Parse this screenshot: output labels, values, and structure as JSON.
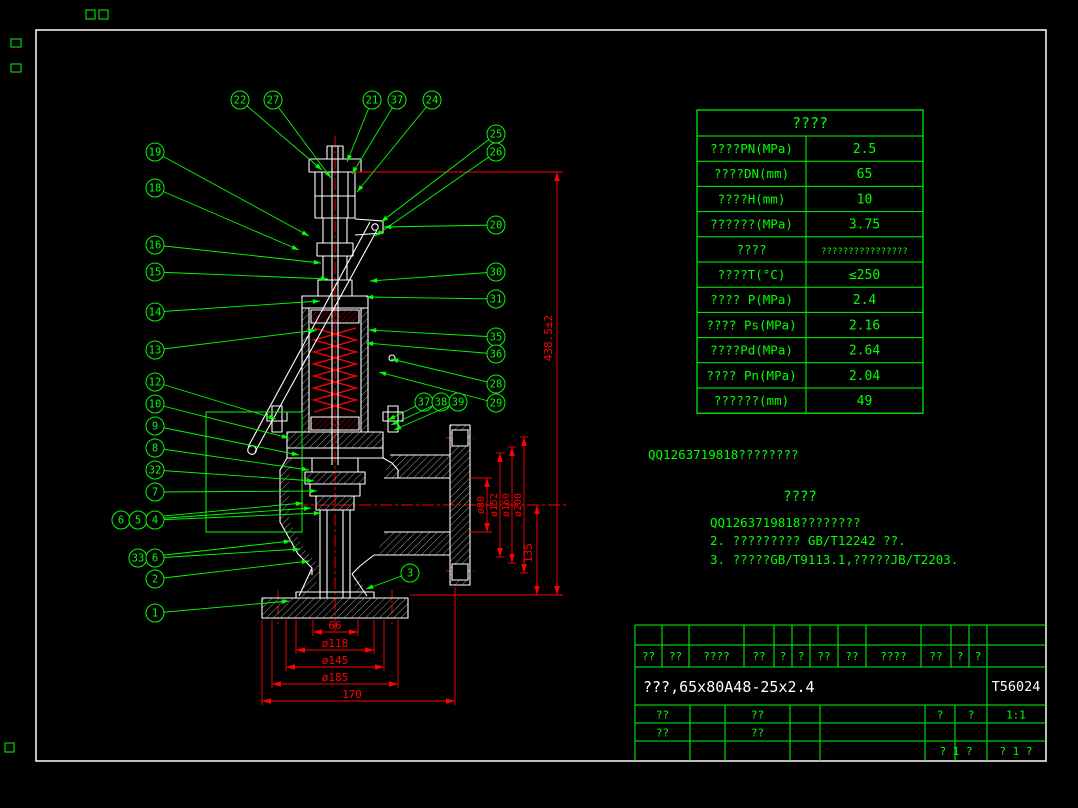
{
  "page": {
    "bg": "#000000",
    "frame_color": "#ffffff",
    "green": "#00ff00",
    "red": "#ff0000"
  },
  "drawing": {
    "callouts": [
      "22",
      "27",
      "21",
      "37",
      "24",
      "25",
      "26",
      "19",
      "18",
      "16",
      "15",
      "14",
      "13",
      "12",
      "10",
      "9",
      "8",
      "32",
      "7",
      "6",
      "5",
      "4",
      "33",
      "6",
      "2",
      "1",
      "3",
      "20",
      "30",
      "31",
      "35",
      "36",
      "28",
      "29",
      "37",
      "38",
      "39"
    ],
    "dims": {
      "main_height": "438.5±2",
      "outlet_to_base": "135",
      "bore": "ø80",
      "flange_d1": "ø152",
      "flange_d2": "ø160",
      "flange_d3": "ø200",
      "neck_width": "66",
      "base_d1": "ø118",
      "base_d2": "ø145",
      "base_d3": "ø185",
      "base_width": "170"
    }
  },
  "spec_table": {
    "title": "????",
    "rows": [
      {
        "label": "????PN(MPa)",
        "value": "2.5"
      },
      {
        "label": "????DN(mm)",
        "value": "65"
      },
      {
        "label": "????H(mm)",
        "value": "10"
      },
      {
        "label": "??????(MPa)",
        "value": "3.75"
      },
      {
        "label": "????",
        "value": "????????????????"
      },
      {
        "label": "????T(°C)",
        "value": "≤250"
      },
      {
        "label": "???? P(MPa)",
        "value": "2.4"
      },
      {
        "label": "???? Ps(MPa)",
        "value": "2.16"
      },
      {
        "label": "????Pd(MPa)",
        "value": "2.64"
      },
      {
        "label": "???? Pn(MPa)",
        "value": "2.04"
      },
      {
        "label": "??????(mm)",
        "value": "49"
      }
    ]
  },
  "watermark": "QQ1263719818????????",
  "notes": {
    "title": "????",
    "lines": [
      "QQ1263719818????????",
      "2. ????????? GB/T12242 ??.",
      "3. ?????GB/T9113.1,?????JB/T2203."
    ]
  },
  "title_block": {
    "header_cells": [
      "??",
      "??",
      "????",
      "??",
      "?",
      "?",
      "??",
      "??",
      "????",
      "??",
      "?",
      "?"
    ],
    "part_number": "???,65x80A48-25x2.4",
    "drawing_number": "T56024",
    "left_rows": [
      [
        "??",
        "??"
      ],
      [
        "??",
        "??"
      ]
    ],
    "scale_cells": [
      "?",
      "?"
    ],
    "scale_value": "1:1",
    "sheet_cells": [
      "? 1 ?",
      "? 1 ?"
    ]
  }
}
